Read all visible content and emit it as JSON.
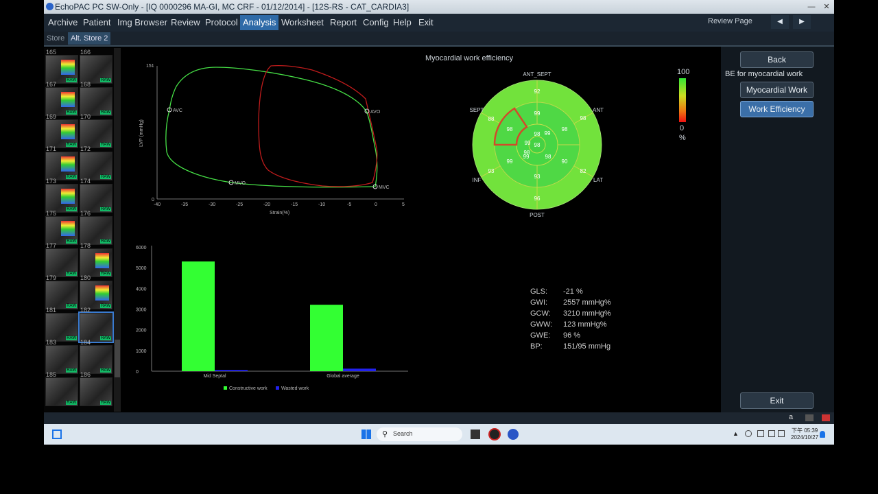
{
  "window": {
    "title": "EchoPAC PC SW-Only - [IQ 0000296 MA-GI, MC CRF - 01/12/2014] - [12S-RS - CAT_CARDIA3]"
  },
  "menu": [
    "Archive",
    "Patient",
    "Img Browser",
    "Review",
    "Protocol",
    "Analysis",
    "Worksheet",
    "Report",
    "Config",
    "Help",
    "Exit"
  ],
  "menu_active": "Analysis",
  "submenu": [
    "Store",
    "Alt. Store 2"
  ],
  "review_page_label": "Review Page",
  "thumbnails": [
    "165",
    "166",
    "167",
    "168",
    "169",
    "170",
    "171",
    "172",
    "173",
    "174",
    "175",
    "176",
    "177",
    "178",
    "179",
    "180",
    "181",
    "182",
    "183",
    "184",
    "185",
    "186"
  ],
  "thumb_raw_label": "RAW",
  "right_panel": {
    "back": "Back",
    "be_label": "BE for myocardial work",
    "myocardial_work": "Myocardial Work",
    "work_efficiency": "Work Efficiency",
    "exit": "Exit"
  },
  "bullseye": {
    "title": "Myocardial work efficiency",
    "labels": {
      "top": "ANT_SEPT",
      "upper_left": "SEPT",
      "upper_right": "ANT",
      "lower_left": "INF",
      "lower_right": "LAT",
      "bottom": "POST"
    },
    "segments": [
      "92",
      "88",
      "98",
      "99",
      "98",
      "98",
      "99",
      "98",
      "93",
      "99",
      "99",
      "98",
      "93",
      "90",
      "82",
      "96",
      "98",
      "99",
      "98"
    ],
    "scale_max": "100",
    "scale_min": "0",
    "scale_unit": "%"
  },
  "loop_chart": {
    "xlabel": "Strain(%)",
    "ylabel": "LVP (mmHg)",
    "xticks": [
      "-40",
      "-35",
      "-30",
      "-25",
      "-20",
      "-15",
      "-10",
      "-5",
      "0",
      "5"
    ],
    "y_max_label": "151",
    "y_min_label": "0",
    "markers": [
      "AVC",
      "AVO",
      "MVO",
      "MVC"
    ]
  },
  "chart_data": {
    "type": "bar",
    "categories": [
      "Mid Septal",
      "Global average"
    ],
    "series": [
      {
        "name": "Constructive work",
        "values": [
          5300,
          3210
        ]
      },
      {
        "name": "Wasted work",
        "values": [
          60,
          123
        ]
      }
    ],
    "ylim": [
      0,
      6000
    ],
    "yticks": [
      "0",
      "1000",
      "2000",
      "3000",
      "4000",
      "5000",
      "6000"
    ],
    "colors": [
      "#33ff33",
      "#2222ee"
    ]
  },
  "stats": [
    {
      "label": "GLS:",
      "value": "-21 %"
    },
    {
      "label": "GWI:",
      "value": "2557 mmHg%"
    },
    {
      "label": "GCW:",
      "value": "3210 mmHg%"
    },
    {
      "label": "GWW:",
      "value": "123 mmHg%"
    },
    {
      "label": "GWE:",
      "value": "96 %"
    },
    {
      "label": "BP:",
      "value": "151/95 mmHg"
    }
  ],
  "taskbar": {
    "search": "Search",
    "time": "下午 05:39",
    "date": "2024/10/27",
    "status_letter": "a"
  }
}
